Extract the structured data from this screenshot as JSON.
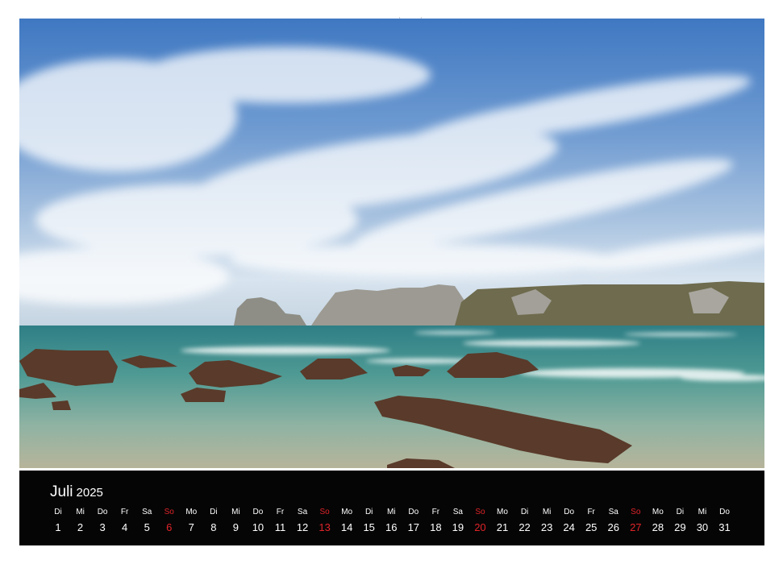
{
  "calendar": {
    "month": "Juli",
    "year": "2025",
    "days": [
      {
        "wd": "Di",
        "num": "1",
        "sun": false
      },
      {
        "wd": "Mi",
        "num": "2",
        "sun": false
      },
      {
        "wd": "Do",
        "num": "3",
        "sun": false
      },
      {
        "wd": "Fr",
        "num": "4",
        "sun": false
      },
      {
        "wd": "Sa",
        "num": "5",
        "sun": false
      },
      {
        "wd": "So",
        "num": "6",
        "sun": true
      },
      {
        "wd": "Mo",
        "num": "7",
        "sun": false
      },
      {
        "wd": "Di",
        "num": "8",
        "sun": false
      },
      {
        "wd": "Mi",
        "num": "9",
        "sun": false
      },
      {
        "wd": "Do",
        "num": "10",
        "sun": false
      },
      {
        "wd": "Fr",
        "num": "11",
        "sun": false
      },
      {
        "wd": "Sa",
        "num": "12",
        "sun": false
      },
      {
        "wd": "So",
        "num": "13",
        "sun": true
      },
      {
        "wd": "Mo",
        "num": "14",
        "sun": false
      },
      {
        "wd": "Di",
        "num": "15",
        "sun": false
      },
      {
        "wd": "Mi",
        "num": "16",
        "sun": false
      },
      {
        "wd": "Do",
        "num": "17",
        "sun": false
      },
      {
        "wd": "Fr",
        "num": "18",
        "sun": false
      },
      {
        "wd": "Sa",
        "num": "19",
        "sun": false
      },
      {
        "wd": "So",
        "num": "20",
        "sun": true
      },
      {
        "wd": "Mo",
        "num": "21",
        "sun": false
      },
      {
        "wd": "Di",
        "num": "22",
        "sun": false
      },
      {
        "wd": "Mi",
        "num": "23",
        "sun": false
      },
      {
        "wd": "Do",
        "num": "24",
        "sun": false
      },
      {
        "wd": "Fr",
        "num": "25",
        "sun": false
      },
      {
        "wd": "Sa",
        "num": "26",
        "sun": false
      },
      {
        "wd": "So",
        "num": "27",
        "sun": true
      },
      {
        "wd": "Mo",
        "num": "28",
        "sun": false
      },
      {
        "wd": "Di",
        "num": "29",
        "sun": false
      },
      {
        "wd": "Mi",
        "num": "30",
        "sun": false
      },
      {
        "wd": "Do",
        "num": "31",
        "sun": false
      }
    ]
  },
  "colors": {
    "sunday": "#e0242a",
    "calendar_bg": "#050505",
    "sky": "#3f78c2",
    "sea": "#3e8f8c"
  }
}
